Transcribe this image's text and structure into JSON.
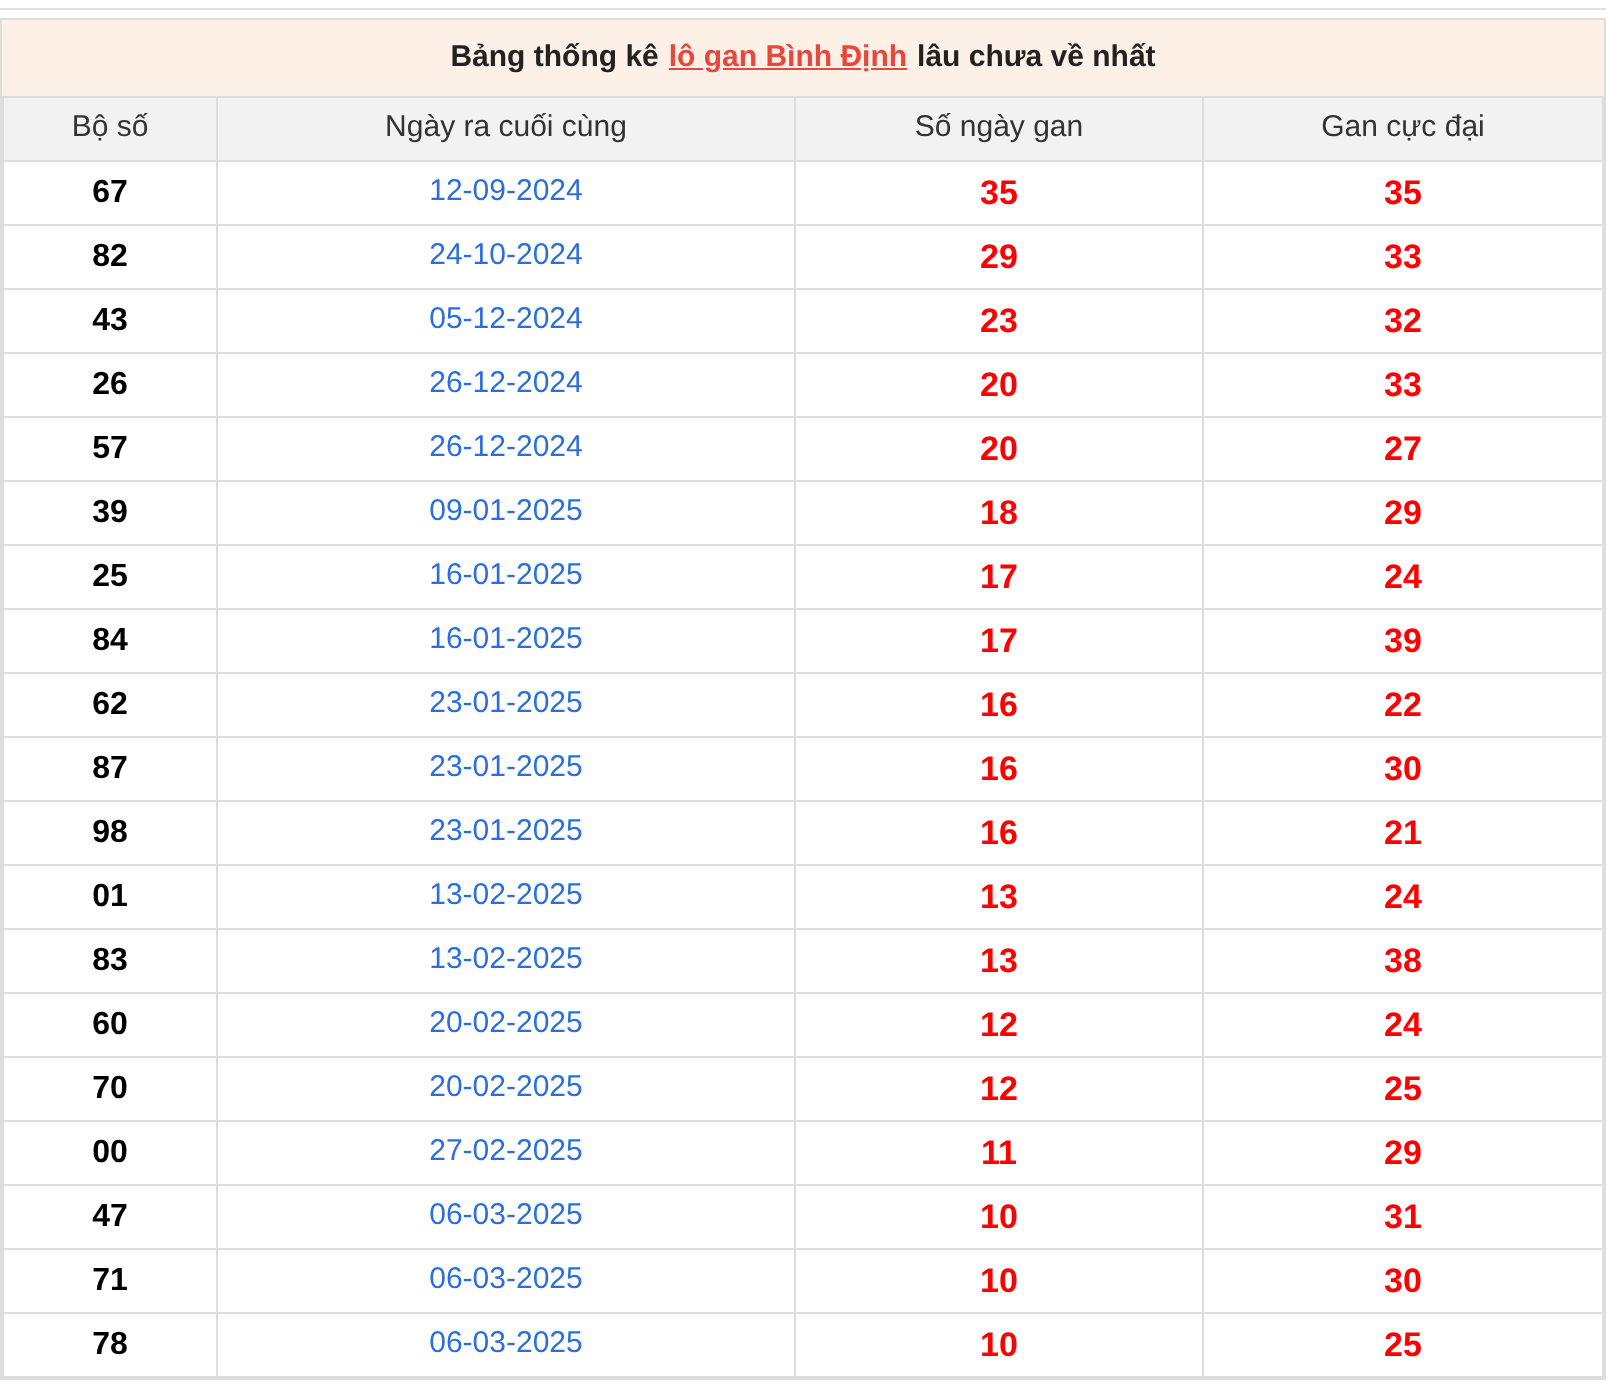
{
  "title": {
    "before": "Bảng thống kê",
    "link": "lô gan Bình Định",
    "after": "lâu chưa về nhất"
  },
  "table": {
    "columns": [
      "Bộ số",
      "Ngày ra cuối cùng",
      "Số ngày gan",
      "Gan cực đại"
    ],
    "rows": [
      [
        "67",
        "12-09-2024",
        "35",
        "35"
      ],
      [
        "82",
        "24-10-2024",
        "29",
        "33"
      ],
      [
        "43",
        "05-12-2024",
        "23",
        "32"
      ],
      [
        "26",
        "26-12-2024",
        "20",
        "33"
      ],
      [
        "57",
        "26-12-2024",
        "20",
        "27"
      ],
      [
        "39",
        "09-01-2025",
        "18",
        "29"
      ],
      [
        "25",
        "16-01-2025",
        "17",
        "24"
      ],
      [
        "84",
        "16-01-2025",
        "17",
        "39"
      ],
      [
        "62",
        "23-01-2025",
        "16",
        "22"
      ],
      [
        "87",
        "23-01-2025",
        "16",
        "30"
      ],
      [
        "98",
        "23-01-2025",
        "16",
        "21"
      ],
      [
        "01",
        "13-02-2025",
        "13",
        "24"
      ],
      [
        "83",
        "13-02-2025",
        "13",
        "38"
      ],
      [
        "60",
        "20-02-2025",
        "12",
        "24"
      ],
      [
        "70",
        "20-02-2025",
        "12",
        "25"
      ],
      [
        "00",
        "27-02-2025",
        "11",
        "29"
      ],
      [
        "47",
        "06-03-2025",
        "10",
        "31"
      ],
      [
        "71",
        "06-03-2025",
        "10",
        "30"
      ],
      [
        "78",
        "06-03-2025",
        "10",
        "25"
      ]
    ]
  }
}
